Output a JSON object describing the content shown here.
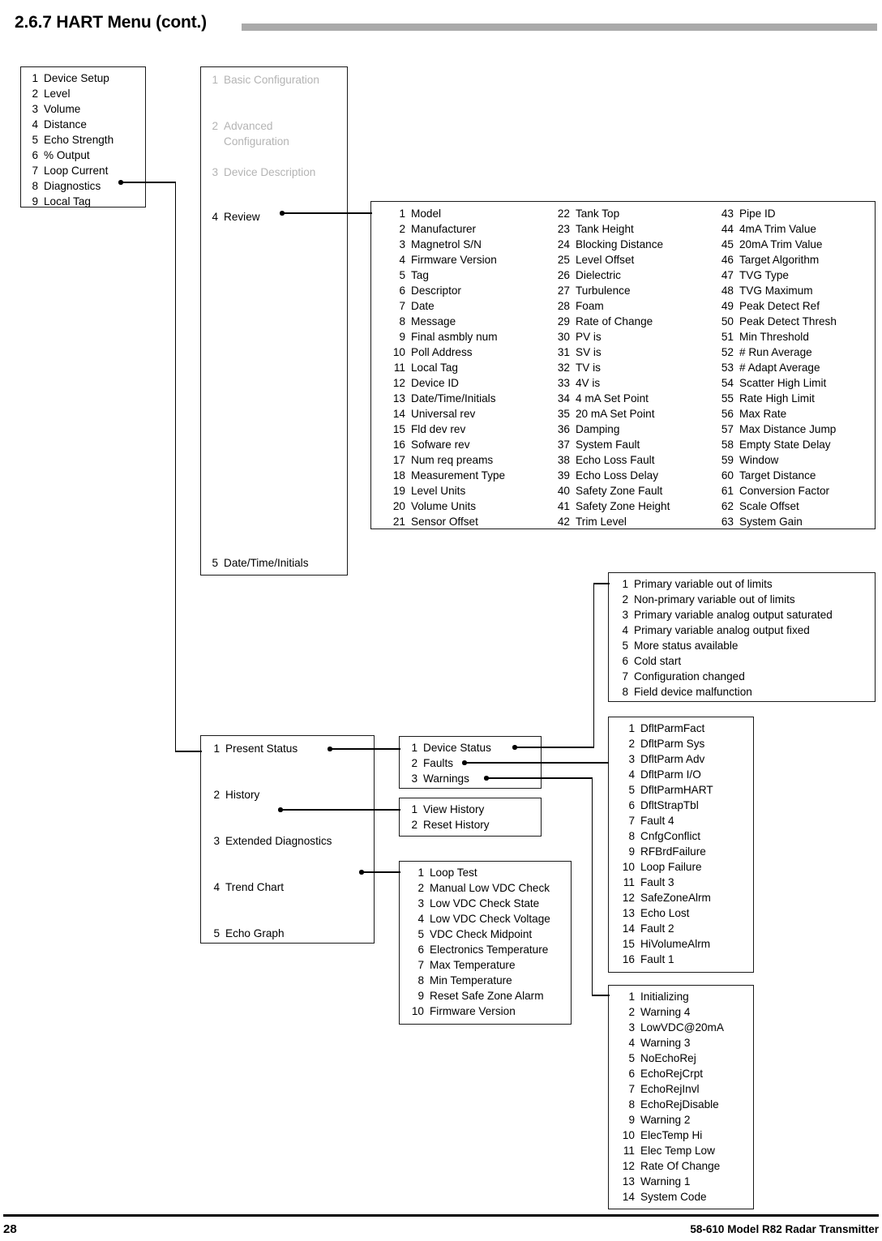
{
  "header": {
    "title": "2.6.7 HART Menu (cont.)"
  },
  "footer": {
    "page_number": "28",
    "document": "58-610 Model R82 Radar Transmitter"
  },
  "main_menu": {
    "items": [
      {
        "num": "1",
        "label": "Device Setup"
      },
      {
        "num": "2",
        "label": "Level"
      },
      {
        "num": "3",
        "label": "Volume"
      },
      {
        "num": "4",
        "label": "Distance"
      },
      {
        "num": "5",
        "label": "Echo Strength"
      },
      {
        "num": "6",
        "label": "% Output"
      },
      {
        "num": "7",
        "label": "Loop Current"
      },
      {
        "num": "8",
        "label": "Diagnostics"
      },
      {
        "num": "9",
        "label": "Local Tag"
      }
    ]
  },
  "device_setup_menu": {
    "items": [
      {
        "num": "1",
        "label": "Basic Configuration",
        "dimmed": true
      },
      {
        "num": "2",
        "label": "Advanced Configuration",
        "dimmed": true
      },
      {
        "num": "3",
        "label": "Device Description",
        "dimmed": true
      },
      {
        "num": "4",
        "label": "Review",
        "dimmed": false
      },
      {
        "num": "5",
        "label": "Date/Time/Initials",
        "dimmed": false
      }
    ]
  },
  "review_menu": {
    "column_1": [
      {
        "num": "1",
        "label": "Model"
      },
      {
        "num": "2",
        "label": "Manufacturer"
      },
      {
        "num": "3",
        "label": "Magnetrol S/N"
      },
      {
        "num": "4",
        "label": "Firmware Version"
      },
      {
        "num": "5",
        "label": "Tag"
      },
      {
        "num": "6",
        "label": "Descriptor"
      },
      {
        "num": "7",
        "label": "Date"
      },
      {
        "num": "8",
        "label": "Message"
      },
      {
        "num": "9",
        "label": "Final asmbly num"
      },
      {
        "num": "10",
        "label": "Poll Address"
      },
      {
        "num": "11",
        "label": "Local Tag"
      },
      {
        "num": "12",
        "label": "Device ID"
      },
      {
        "num": "13",
        "label": "Date/Time/Initials"
      },
      {
        "num": "14",
        "label": "Universal rev"
      },
      {
        "num": "15",
        "label": "Fld dev rev"
      },
      {
        "num": "16",
        "label": "Sofware rev"
      },
      {
        "num": "17",
        "label": "Num req preams"
      },
      {
        "num": "18",
        "label": "Measurement Type"
      },
      {
        "num": "19",
        "label": "Level Units"
      },
      {
        "num": "20",
        "label": "Volume Units"
      },
      {
        "num": "21",
        "label": "Sensor Offset"
      }
    ],
    "column_2": [
      {
        "num": "22",
        "label": "Tank Top"
      },
      {
        "num": "23",
        "label": "Tank Height"
      },
      {
        "num": "24",
        "label": "Blocking Distance"
      },
      {
        "num": "25",
        "label": "Level Offset"
      },
      {
        "num": "26",
        "label": "Dielectric"
      },
      {
        "num": "27",
        "label": "Turbulence"
      },
      {
        "num": "28",
        "label": "Foam"
      },
      {
        "num": "29",
        "label": "Rate of Change"
      },
      {
        "num": "30",
        "label": "PV is"
      },
      {
        "num": "31",
        "label": "SV is"
      },
      {
        "num": "32",
        "label": "TV is"
      },
      {
        "num": "33",
        "label": "4V is"
      },
      {
        "num": "34",
        "label": "4 mA Set Point"
      },
      {
        "num": "35",
        "label": "20 mA Set Point"
      },
      {
        "num": "36",
        "label": "Damping"
      },
      {
        "num": "37",
        "label": "System Fault"
      },
      {
        "num": "38",
        "label": "Echo Loss Fault"
      },
      {
        "num": "39",
        "label": "Echo Loss Delay"
      },
      {
        "num": "40",
        "label": "Safety Zone Fault"
      },
      {
        "num": "41",
        "label": "Safety Zone Height"
      },
      {
        "num": "42",
        "label": "Trim Level"
      }
    ],
    "column_3": [
      {
        "num": "43",
        "label": "Pipe ID"
      },
      {
        "num": "44",
        "label": "4mA Trim Value"
      },
      {
        "num": "45",
        "label": "20mA Trim Value"
      },
      {
        "num": "46",
        "label": "Target Algorithm"
      },
      {
        "num": "47",
        "label": "TVG Type"
      },
      {
        "num": "48",
        "label": "TVG Maximum"
      },
      {
        "num": "49",
        "label": "Peak Detect Ref"
      },
      {
        "num": "50",
        "label": "Peak Detect Thresh"
      },
      {
        "num": "51",
        "label": "Min Threshold"
      },
      {
        "num": "52",
        "label": "# Run Average"
      },
      {
        "num": "53",
        "label": "# Adapt Average"
      },
      {
        "num": "54",
        "label": "Scatter High Limit"
      },
      {
        "num": "55",
        "label": "Rate High Limit"
      },
      {
        "num": "56",
        "label": "Max Rate"
      },
      {
        "num": "57",
        "label": "Max Distance Jump"
      },
      {
        "num": "58",
        "label": "Empty State Delay"
      },
      {
        "num": "59",
        "label": "Window"
      },
      {
        "num": "60",
        "label": "Target Distance"
      },
      {
        "num": "61",
        "label": "Conversion Factor"
      },
      {
        "num": "62",
        "label": "Scale Offset"
      },
      {
        "num": "63",
        "label": "System Gain"
      }
    ]
  },
  "diagnostics_menu": {
    "items": [
      {
        "num": "1",
        "label": "Present Status"
      },
      {
        "num": "2",
        "label": "History"
      },
      {
        "num": "3",
        "label": "Extended Diagnostics"
      },
      {
        "num": "4",
        "label": "Trend Chart"
      },
      {
        "num": "5",
        "label": "Echo Graph"
      }
    ]
  },
  "present_status_menu": {
    "items": [
      {
        "num": "1",
        "label": "Device Status"
      },
      {
        "num": "2",
        "label": "Faults"
      },
      {
        "num": "3",
        "label": "Warnings"
      }
    ]
  },
  "history_menu": {
    "items": [
      {
        "num": "1",
        "label": "View History"
      },
      {
        "num": "2",
        "label": "Reset History"
      }
    ]
  },
  "extended_diagnostics_menu": {
    "items": [
      {
        "num": "1",
        "label": "Loop Test"
      },
      {
        "num": "2",
        "label": "Manual Low VDC Check"
      },
      {
        "num": "3",
        "label": "Low VDC Check State"
      },
      {
        "num": "4",
        "label": "Low VDC Check Voltage"
      },
      {
        "num": "5",
        "label": "VDC Check Midpoint"
      },
      {
        "num": "6",
        "label": "Electronics Temperature"
      },
      {
        "num": "7",
        "label": "Max Temperature"
      },
      {
        "num": "8",
        "label": "Min Temperature"
      },
      {
        "num": "9",
        "label": "Reset Safe Zone Alarm"
      },
      {
        "num": "10",
        "label": "Firmware Version"
      }
    ]
  },
  "device_status_menu": {
    "items": [
      {
        "num": "1",
        "label": "Primary variable out of limits"
      },
      {
        "num": "2",
        "label": "Non-primary variable out of limits"
      },
      {
        "num": "3",
        "label": "Primary variable analog output saturated"
      },
      {
        "num": "4",
        "label": "Primary variable analog output fixed"
      },
      {
        "num": "5",
        "label": "More status available"
      },
      {
        "num": "6",
        "label": "Cold start"
      },
      {
        "num": "7",
        "label": "Configuration changed"
      },
      {
        "num": "8",
        "label": "Field device malfunction"
      }
    ]
  },
  "faults_menu": {
    "items": [
      {
        "num": "1",
        "label": "DfltParmFact"
      },
      {
        "num": "2",
        "label": "DfltParm Sys"
      },
      {
        "num": "3",
        "label": "DfltParm Adv"
      },
      {
        "num": "4",
        "label": "DfltParm I/O"
      },
      {
        "num": "5",
        "label": "DfltParmHART"
      },
      {
        "num": "6",
        "label": "DfltStrapTbl"
      },
      {
        "num": "7",
        "label": "Fault 4"
      },
      {
        "num": "8",
        "label": "CnfgConflict"
      },
      {
        "num": "9",
        "label": "RFBrdFailure"
      },
      {
        "num": "10",
        "label": "Loop Failure"
      },
      {
        "num": "11",
        "label": "Fault 3"
      },
      {
        "num": "12",
        "label": "SafeZoneAlrm"
      },
      {
        "num": "13",
        "label": "Echo Lost"
      },
      {
        "num": "14",
        "label": "Fault 2"
      },
      {
        "num": "15",
        "label": "HiVolumeAlrm"
      },
      {
        "num": "16",
        "label": "Fault 1"
      }
    ]
  },
  "warnings_menu": {
    "items": [
      {
        "num": "1",
        "label": "Initializing"
      },
      {
        "num": "2",
        "label": "Warning 4"
      },
      {
        "num": "3",
        "label": "LowVDC@20mA"
      },
      {
        "num": "4",
        "label": "Warning 3"
      },
      {
        "num": "5",
        "label": "NoEchoRej"
      },
      {
        "num": "6",
        "label": "EchoRejCrpt"
      },
      {
        "num": "7",
        "label": "EchoRejInvl"
      },
      {
        "num": "8",
        "label": "EchoRejDisable"
      },
      {
        "num": "9",
        "label": "Warning 2"
      },
      {
        "num": "10",
        "label": "ElecTemp Hi"
      },
      {
        "num": "11",
        "label": "Elec Temp Low"
      },
      {
        "num": "12",
        "label": "Rate Of Change"
      },
      {
        "num": "13",
        "label": "Warning 1"
      },
      {
        "num": "14",
        "label": "System Code"
      }
    ]
  },
  "colors": {
    "rule": "#aaaaaa",
    "box_border": "#1a1a1a",
    "dimmed_text": "#b4b4b4",
    "text": "#000000"
  }
}
